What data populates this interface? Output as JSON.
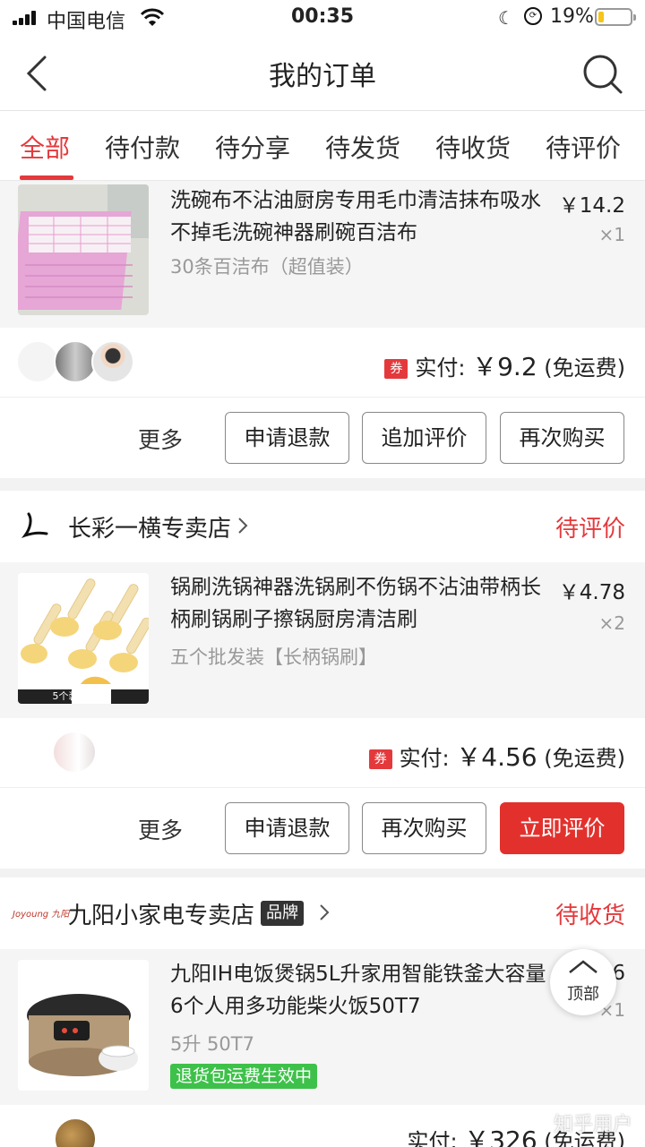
{
  "status_bar": {
    "carrier": "中国电信",
    "time": "00:35",
    "battery_pct": "19%",
    "battery_level": 0.19
  },
  "header": {
    "title": "我的订单"
  },
  "tabs": [
    {
      "label": "全部",
      "active": true
    },
    {
      "label": "待付款"
    },
    {
      "label": "待分享"
    },
    {
      "label": "待发货"
    },
    {
      "label": "待收货"
    },
    {
      "label": "待评价"
    }
  ],
  "orders": [
    {
      "product": {
        "title": "洗碗布不沾油厨房专用毛巾清洁抹布吸水不掉毛洗碗神器刷碗百洁布",
        "spec": "30条百洁布（超值装）",
        "price": "￥14.2",
        "qty": "×1"
      },
      "payment": {
        "label": "实付: ",
        "amount": "￥9.2",
        "note": " (免运费)",
        "coupon": "券"
      },
      "actions": {
        "more": "更多",
        "b1": "申请退款",
        "b2": "追加评价",
        "b3": "再次购买"
      }
    },
    {
      "store": {
        "name": "长彩一横专卖店",
        "status": "待评价"
      },
      "product": {
        "title": "锅刷洗锅神器洗锅刷不伤锅不沾油带柄长柄刷锅刷子擦锅厨房清洁刷",
        "spec": "五个批发装【长柄锅刷】",
        "price": "￥4.78",
        "qty": "×2",
        "thumb_caption": "5个装  分享）"
      },
      "payment": {
        "label": "实付: ",
        "amount": "￥4.56",
        "note": " (免运费)",
        "coupon": "券"
      },
      "actions": {
        "more": "更多",
        "b1": "申请退款",
        "b2": "再次购买",
        "b3": "立即评价"
      }
    },
    {
      "store": {
        "name": "九阳小家电专卖店",
        "brand": "品牌",
        "status": "待收货",
        "logo_text": "Joyoung 九阳"
      },
      "product": {
        "title": "九阳IH电饭煲锅5L升家用智能铁釜大容量6个人用多功能柴火饭50T7",
        "spec": "5升 50T7",
        "price": "6",
        "qty": "×1",
        "tag": "退货包运费生效中"
      },
      "payment": {
        "label": "实付: ",
        "amount": "￥326",
        "note": " (免运费)"
      }
    }
  ],
  "fab": {
    "label": "顶部"
  },
  "watermark": "知乎用户"
}
